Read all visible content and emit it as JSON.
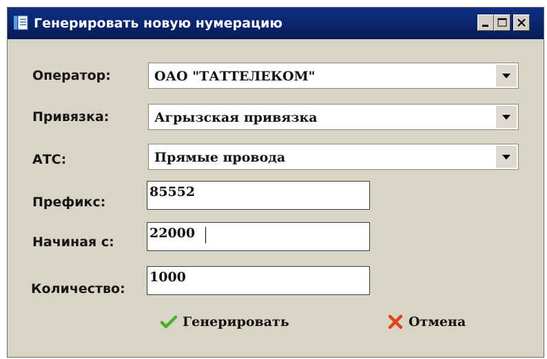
{
  "window": {
    "title": "Генерировать новую нумерацию",
    "icon": "app-document-icon",
    "controls": [
      "minimize-icon",
      "maximize-icon",
      "close-icon"
    ]
  },
  "form": {
    "operator": {
      "label": "Оператор:",
      "value": "ОАО \"ТАТТЕЛЕКОМ\""
    },
    "binding": {
      "label": "Привязка:",
      "value": "Агрызская привязка"
    },
    "ats": {
      "label": "АТС:",
      "value": "Прямые провода"
    },
    "prefix": {
      "label": "Префикс:",
      "value": "85552"
    },
    "start": {
      "label": "Начиная с:",
      "value": "22000"
    },
    "count": {
      "label": "Количество:",
      "value": "1000"
    }
  },
  "buttons": {
    "generate": {
      "label": "Генерировать",
      "icon": "checkmark-icon",
      "color": "#4caf2a"
    },
    "cancel": {
      "label": "Отмена",
      "icon": "cross-icon",
      "color": "#e0401a"
    }
  },
  "colors": {
    "titlebar": "#0a246a",
    "window_bg": "#d9d5c6"
  }
}
